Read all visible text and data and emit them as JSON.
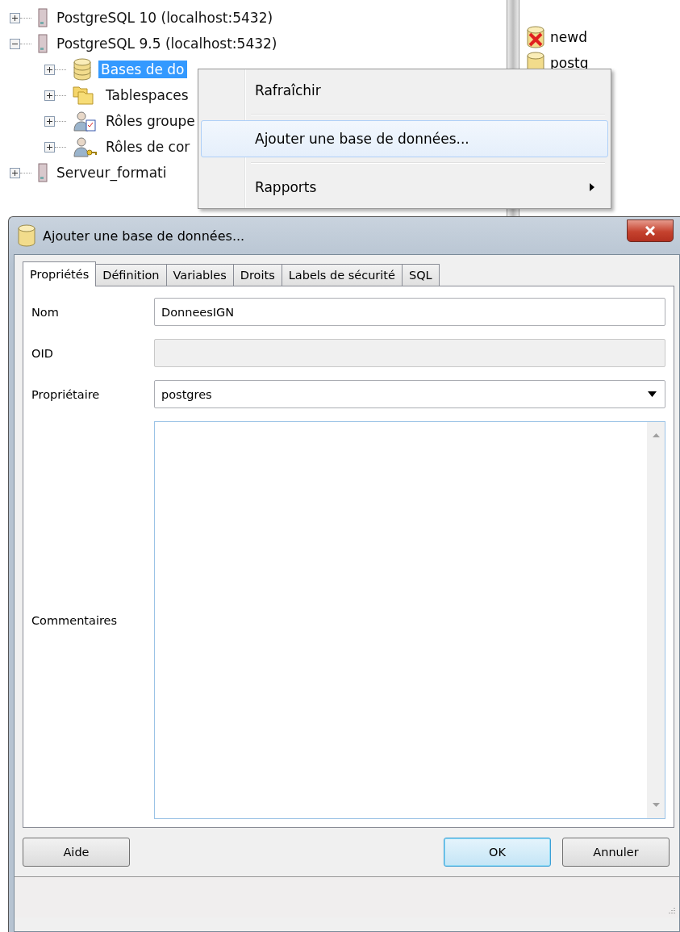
{
  "tree": [
    {
      "label": "PostgreSQL 10 (localhost:5432)",
      "kind": "server",
      "expanded": false,
      "selected": false
    },
    {
      "label": "PostgreSQL 9.5 (localhost:5432)",
      "kind": "server",
      "expanded": true,
      "selected": false,
      "children": [
        {
          "label": "Bases de do",
          "kind": "databases",
          "expanded": false,
          "selected": true
        },
        {
          "label": "Tablespaces",
          "kind": "tablespaces",
          "expanded": false,
          "selected": false
        },
        {
          "label": "Rôles groupe",
          "kind": "group-roles",
          "expanded": false,
          "selected": false
        },
        {
          "label": "Rôles de cor",
          "kind": "login-roles",
          "expanded": false,
          "selected": false
        }
      ]
    },
    {
      "label": "Serveur_formati",
      "kind": "server",
      "expanded": false,
      "selected": false
    }
  ],
  "side_list": [
    {
      "label": "newd",
      "kind": "broken-database"
    },
    {
      "label": "postg",
      "kind": "database"
    }
  ],
  "context_menu": [
    {
      "kind": "item",
      "label": "Rafraîchir",
      "highlighted": false,
      "submenu": false
    },
    {
      "kind": "separator"
    },
    {
      "kind": "item",
      "label": "Ajouter une base de données...",
      "highlighted": true,
      "submenu": false
    },
    {
      "kind": "separator"
    },
    {
      "kind": "item",
      "label": "Rapports",
      "highlighted": false,
      "submenu": true
    }
  ],
  "dialog": {
    "title": "Ajouter une base de données...",
    "tabs": [
      {
        "label": "Propriétés",
        "selected": true
      },
      {
        "label": "Définition",
        "selected": false
      },
      {
        "label": "Variables",
        "selected": false
      },
      {
        "label": "Droits",
        "selected": false
      },
      {
        "label": "Labels de sécurité",
        "selected": false
      },
      {
        "label": "SQL",
        "selected": false
      }
    ],
    "fields": [
      {
        "label": "Nom",
        "kind": "text",
        "value": "DonneesIGN",
        "disabled": false
      },
      {
        "label": "OID",
        "kind": "text",
        "disabled": true
      },
      {
        "label": "Propriétaire",
        "kind": "select",
        "value": "postgres",
        "disabled": false
      },
      {
        "label": "Commentaires",
        "kind": "textarea",
        "disabled": false
      }
    ],
    "buttons": [
      {
        "label": "Aide",
        "default": false
      },
      {
        "label": "OK",
        "default": true
      },
      {
        "label": "Annuler",
        "default": false
      }
    ]
  }
}
